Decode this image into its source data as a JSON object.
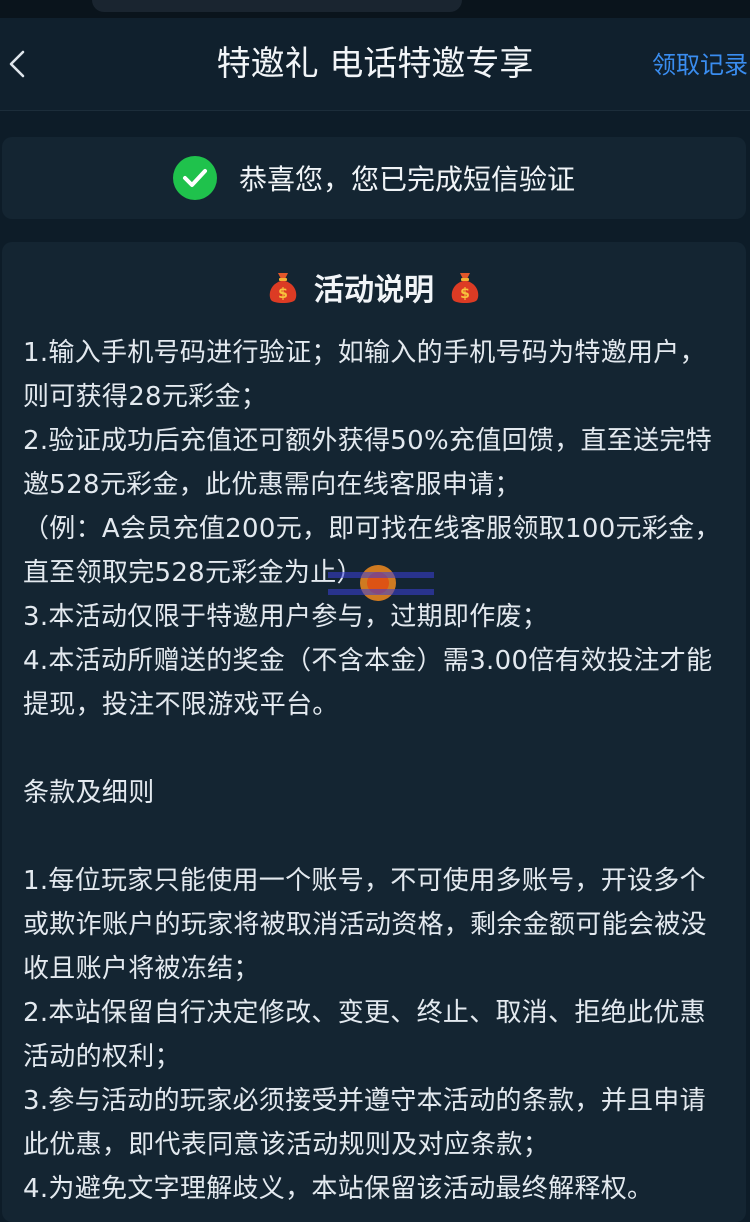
{
  "header": {
    "title": "特邀礼 电话特邀专享",
    "records_label": "领取记录"
  },
  "verify": {
    "message": "恭喜您，您已完成短信验证"
  },
  "activity": {
    "section_title": "活动说明",
    "rules": [
      "1.输入手机号码进行验证；如输入的手机号码为特邀用户，则可获得28元彩金；",
      "2.验证成功后充值还可额外获得50%充值回馈，直至送完特邀528元彩金，此优惠需向在线客服申请；",
      "（例：A会员充值200元，即可找在线客服领取100元彩金，直至领取完528元彩金为止）",
      "3.本活动仅限于特邀用户参与，过期即作废；",
      "4.本活动所赠送的奖金（不含本金）需3.00倍有效投注才能提现，投注不限游戏平台。"
    ],
    "terms_title": "条款及细则",
    "terms": [
      "1.每位玩家只能使用一个账号，不可使用多账号，开设多个或欺诈账户的玩家将被取消活动资格，剩余金额可能会被没收且账户将被冻结；",
      "2.本站保留自行决定修改、变更、终止、取消、拒绝此优惠活动的权利；",
      "3.参与活动的玩家必须接受并遵守本活动的条款，并且申请此优惠，即代表同意该活动规则及对应条款；",
      "4.为避免文字理解歧义，本站保留该活动最终解释权。"
    ]
  },
  "colors": {
    "background": "#0d1c28",
    "card": "#142532",
    "accent_link": "#3a8df0",
    "success": "#1fc24c"
  },
  "icons": [
    "back-arrow-icon",
    "check-circle-icon",
    "money-bag-icon"
  ]
}
